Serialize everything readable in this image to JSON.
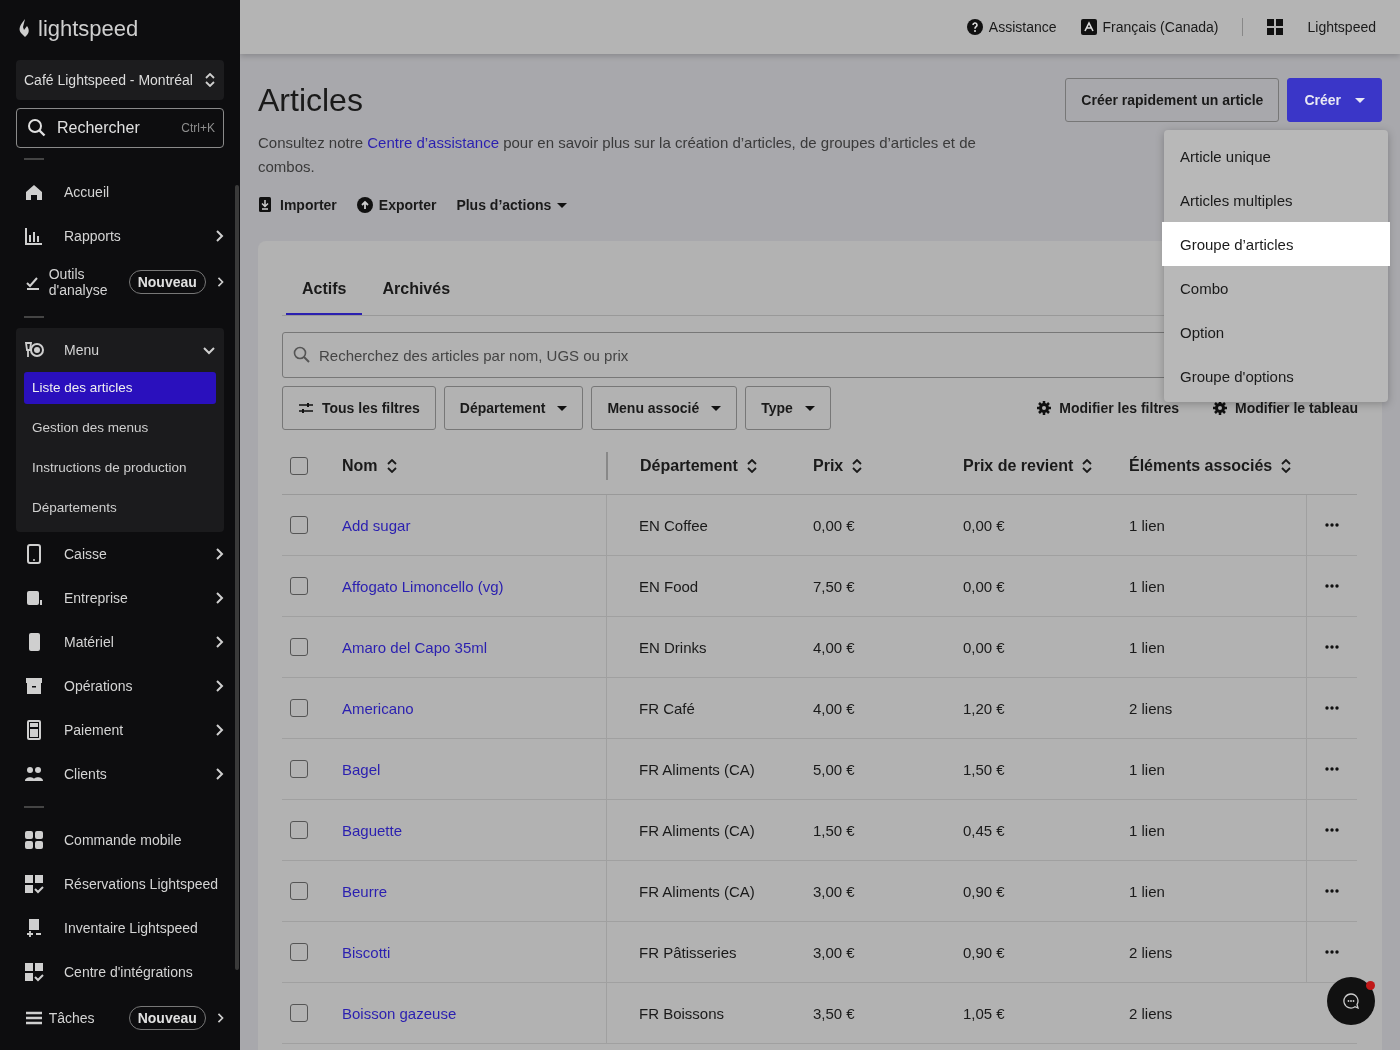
{
  "sidebar": {
    "logo": "lightspeed",
    "location": "Café Lightspeed - Montréal",
    "search": {
      "placeholder": "Rechercher",
      "shortcut": "Ctrl+K"
    },
    "sections": [
      {
        "items": [
          {
            "label": "Accueil",
            "has_submenu": false
          },
          {
            "label": "Rapports",
            "has_submenu": true
          },
          {
            "label": "Outils d'analyse",
            "badge": "Nouveau",
            "has_submenu": true
          }
        ]
      },
      {
        "items": [
          {
            "label": "Menu",
            "has_submenu": true,
            "expanded": true,
            "children": [
              {
                "label": "Liste des articles",
                "selected": true
              },
              {
                "label": "Gestion des menus",
                "selected": false
              },
              {
                "label": "Instructions de production",
                "selected": false
              },
              {
                "label": "Départements",
                "selected": false
              }
            ]
          },
          {
            "label": "Caisse",
            "has_submenu": true
          },
          {
            "label": "Entreprise",
            "has_submenu": true
          },
          {
            "label": "Matériel",
            "has_submenu": true
          },
          {
            "label": "Opérations",
            "has_submenu": true
          },
          {
            "label": "Paiement",
            "has_submenu": true
          },
          {
            "label": "Clients",
            "has_submenu": true
          }
        ]
      },
      {
        "items": [
          {
            "label": "Commande mobile",
            "has_submenu": false
          },
          {
            "label": "Réservations Lightspeed",
            "has_submenu": false
          },
          {
            "label": "Inventaire Lightspeed",
            "has_submenu": false
          },
          {
            "label": "Centre d'intégrations",
            "has_submenu": false
          },
          {
            "label": "Tâches",
            "badge": "Nouveau",
            "has_submenu": true
          }
        ]
      }
    ]
  },
  "topbar": {
    "help": "Assistance",
    "language": "Français (Canada)",
    "account": "Lightspeed"
  },
  "header": {
    "title": "Articles",
    "description_before": "Consultez notre ",
    "description_link": "Centre d’assistance",
    "description_after": " pour en savoir plus sur la création d’articles, de groupes d’articles et de combos.",
    "actions": [
      {
        "label": "Importer",
        "kind": "import"
      },
      {
        "label": "Exporter",
        "kind": "export"
      },
      {
        "label": "Plus d’actions",
        "kind": "menu"
      }
    ],
    "quick_create": "Créer rapidement un article",
    "create": "Créer"
  },
  "create_menu": [
    {
      "label": "Article unique",
      "selected": false
    },
    {
      "label": "Articles multiples",
      "selected": false
    },
    {
      "label": "Groupe d’articles",
      "selected": true
    },
    {
      "label": "Combo",
      "selected": false
    },
    {
      "label": "Option",
      "selected": false
    },
    {
      "label": "Groupe d'options",
      "selected": false
    }
  ],
  "tabs": [
    {
      "label": "Actifs",
      "selected": true
    },
    {
      "label": "Archivés",
      "selected": false
    }
  ],
  "search": {
    "placeholder": "Recherchez des articles par nom, UGS ou prix"
  },
  "filters": [
    {
      "label": "Tous les filtres",
      "kind": "all"
    },
    {
      "label": "Département",
      "kind": "dropdown"
    },
    {
      "label": "Menu associé",
      "kind": "dropdown"
    },
    {
      "label": "Type",
      "kind": "dropdown"
    }
  ],
  "filter_links": [
    "Modifier les filtres",
    "Modifier le tableau"
  ],
  "table": {
    "all_checked": false,
    "columns": [
      "Nom",
      "Département",
      "Prix",
      "Prix de revient",
      "Éléments associés"
    ],
    "rows": [
      {
        "checked": false,
        "cells": [
          "Add sugar",
          "EN Coffee",
          "0,00 €",
          "0,00 €",
          "1 lien"
        ]
      },
      {
        "checked": false,
        "cells": [
          "Affogato Limoncello (vg)",
          "EN Food",
          "7,50 €",
          "0,00 €",
          "1 lien"
        ]
      },
      {
        "checked": false,
        "cells": [
          "Amaro del Capo 35ml",
          "EN Drinks",
          "4,00 €",
          "0,00 €",
          "1 lien"
        ]
      },
      {
        "checked": false,
        "cells": [
          "Americano",
          "FR Café",
          "4,00 €",
          "1,20 €",
          "2 liens"
        ]
      },
      {
        "checked": false,
        "cells": [
          "Bagel",
          "FR Aliments (CA)",
          "5,00 €",
          "1,50 €",
          "1 lien"
        ]
      },
      {
        "checked": false,
        "cells": [
          "Baguette",
          "FR Aliments (CA)",
          "1,50 €",
          "0,45 €",
          "1 lien"
        ]
      },
      {
        "checked": false,
        "cells": [
          "Beurre",
          "FR Aliments (CA)",
          "3,00 €",
          "0,90 €",
          "1 lien"
        ]
      },
      {
        "checked": false,
        "cells": [
          "Biscotti",
          "FR Pâtisseries",
          "3,00 €",
          "0,90 €",
          "2 liens"
        ]
      },
      {
        "checked": false,
        "cells": [
          "Boisson gazeuse",
          "FR Boissons",
          "3,50 €",
          "1,05 €",
          "2 liens"
        ]
      }
    ]
  },
  "chat": {
    "unread": true
  }
}
